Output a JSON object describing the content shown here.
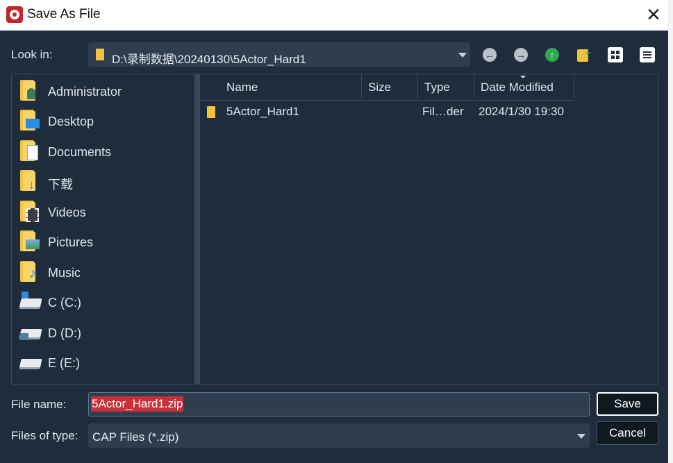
{
  "window": {
    "title": "Save As File"
  },
  "look_in": {
    "label": "Look in:",
    "path": "D:\\录制数据\\20240130\\5Actor_Hard1"
  },
  "toolbar": {
    "back": "back-icon",
    "forward": "forward-icon",
    "up": "up-folder-icon",
    "new_folder": "new-folder-icon",
    "view_icons": "grid-view-icon",
    "view_details": "details-view-icon"
  },
  "places": [
    {
      "label": "Administrator",
      "icon": "user-folder-icon"
    },
    {
      "label": "Desktop",
      "icon": "desktop-folder-icon"
    },
    {
      "label": "Documents",
      "icon": "documents-folder-icon"
    },
    {
      "label": "下载",
      "icon": "downloads-folder-icon"
    },
    {
      "label": "Videos",
      "icon": "videos-folder-icon"
    },
    {
      "label": "Pictures",
      "icon": "pictures-folder-icon"
    },
    {
      "label": "Music",
      "icon": "music-folder-icon"
    },
    {
      "label": "C (C:)",
      "icon": "drive-icon"
    },
    {
      "label": "D (D:)",
      "icon": "drive-icon"
    },
    {
      "label": "E (E:)",
      "icon": "drive-icon"
    }
  ],
  "columns": {
    "name": "Name",
    "size": "Size",
    "type": "Type",
    "date": "Date Modified"
  },
  "files": [
    {
      "name": "5Actor_Hard1",
      "size": "",
      "type": "Fil…der",
      "date": "2024/1/30 19:30"
    }
  ],
  "file_name": {
    "label": "File name:",
    "value": "5Actor_Hard1.zip"
  },
  "file_type": {
    "label": "Files of type:",
    "value": "CAP Files (*.zip)"
  },
  "buttons": {
    "save": "Save",
    "cancel": "Cancel"
  },
  "colors": {
    "background": "#1f2c3b",
    "accent_selection": "#c9313a",
    "folder": "#f0c244"
  }
}
